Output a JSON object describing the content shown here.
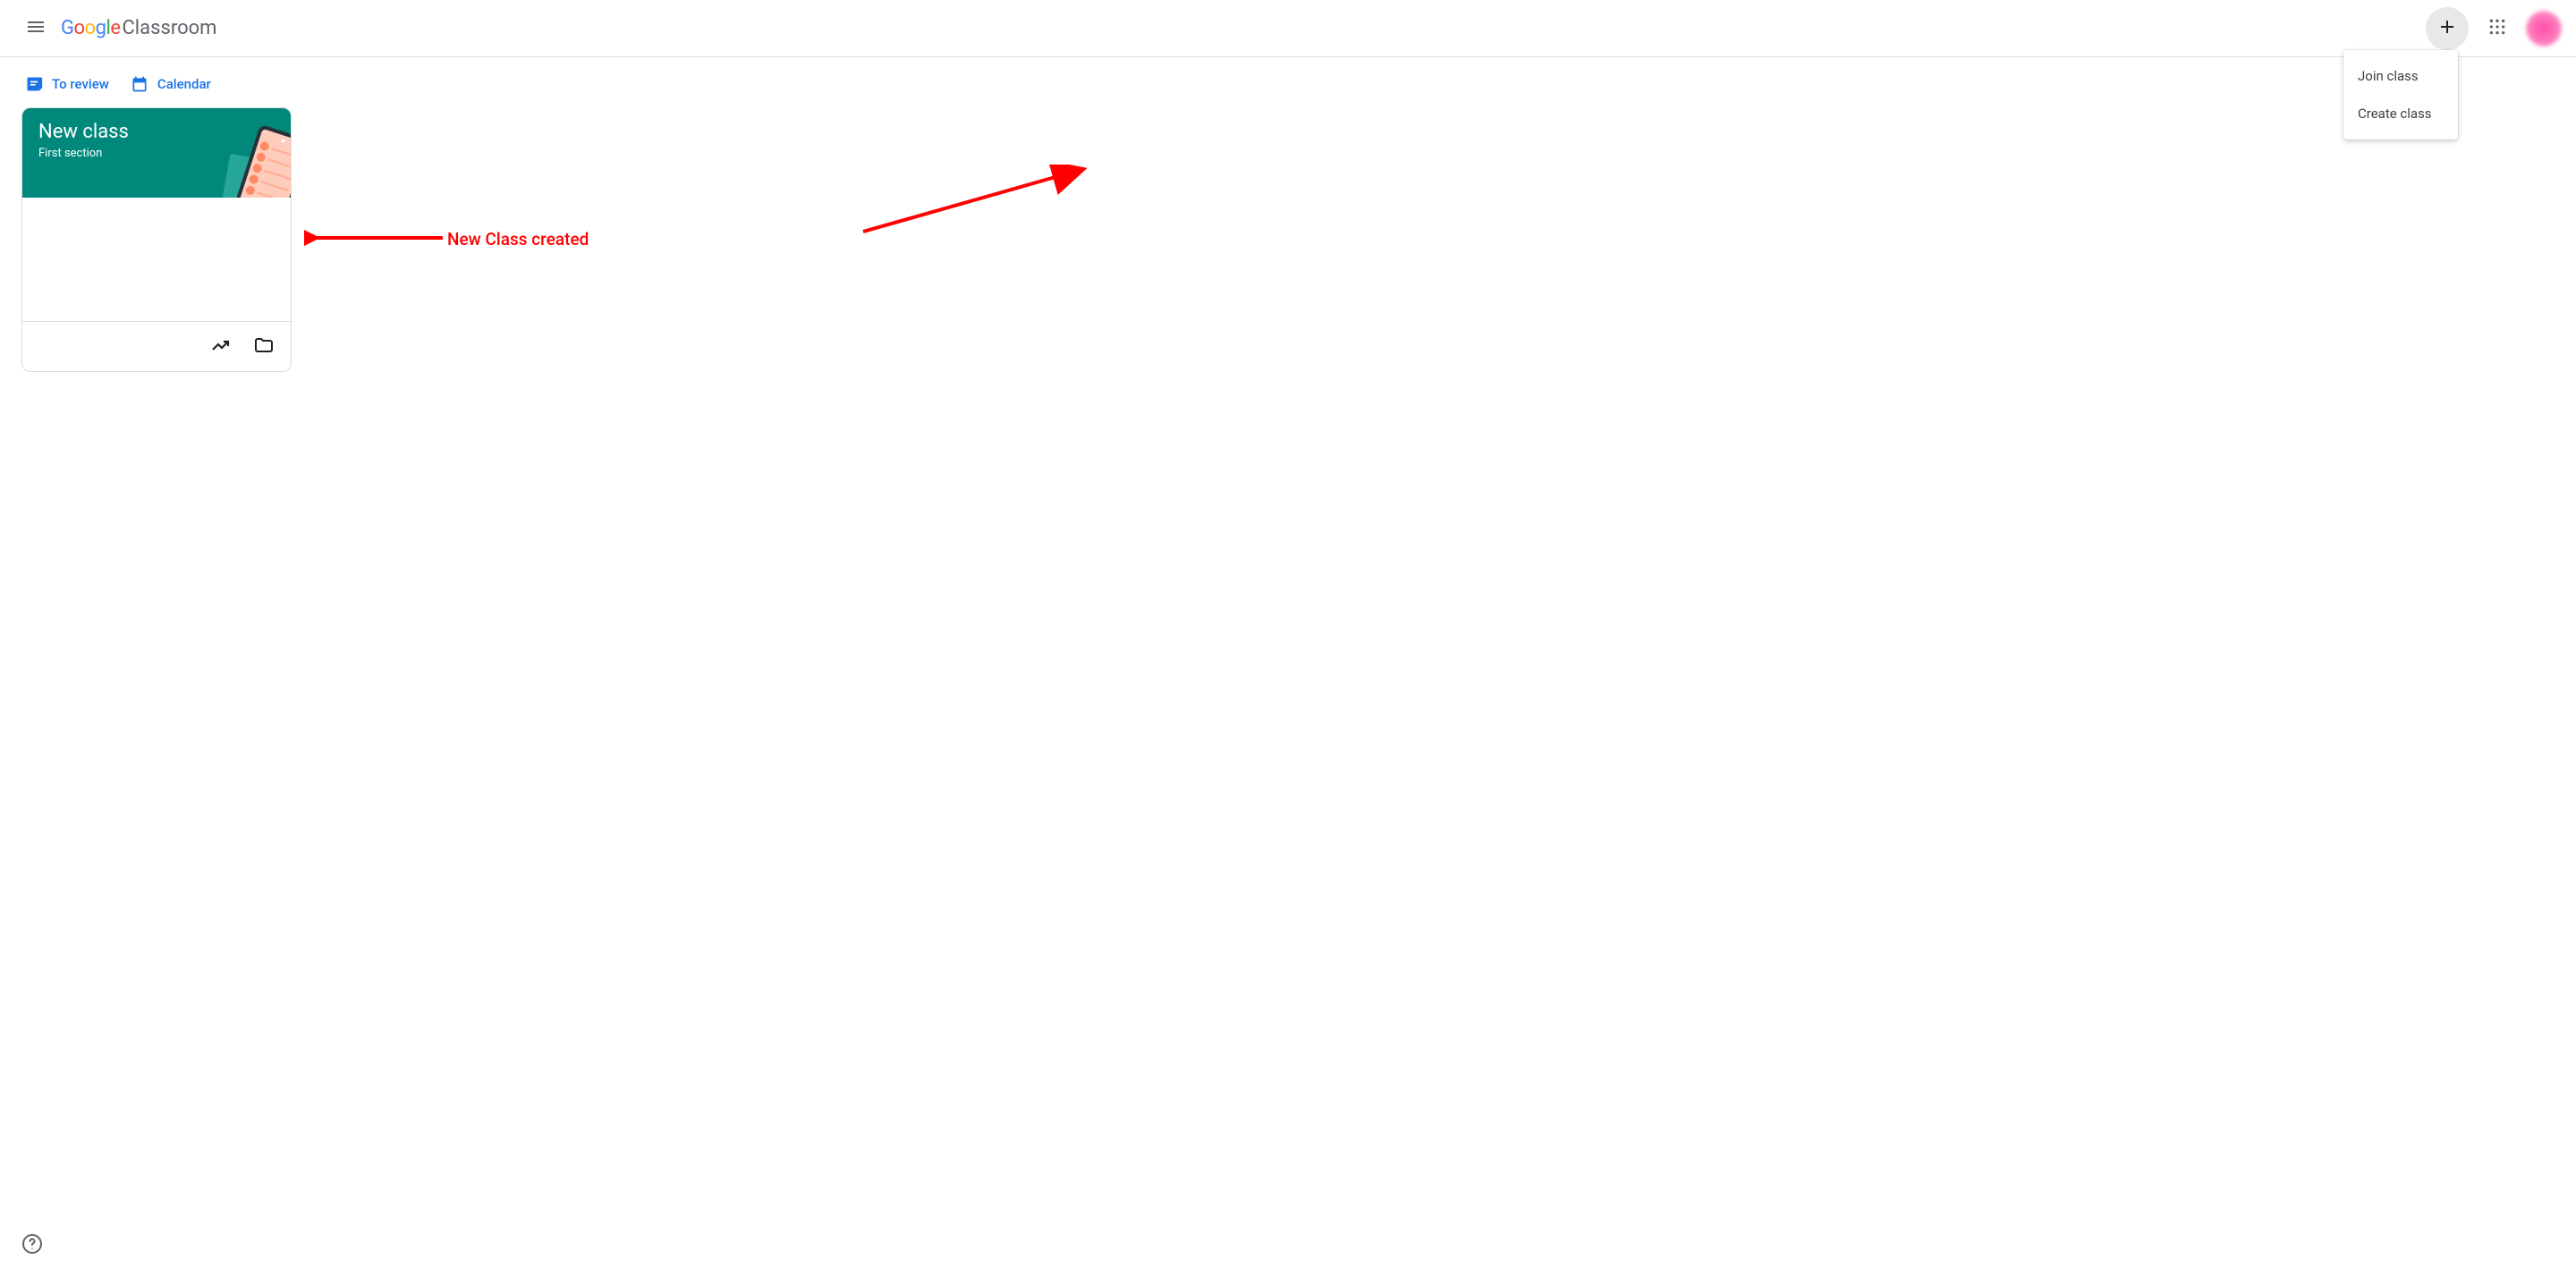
{
  "header": {
    "logo_google": "Google",
    "logo_product": "Classroom"
  },
  "dropdown": {
    "join_label": "Join class",
    "create_label": "Create class"
  },
  "toolbar": {
    "review_label": "To review",
    "calendar_label": "Calendar"
  },
  "cards": [
    {
      "title": "New class",
      "section": "First section"
    }
  ],
  "annotations": {
    "created_label": "New Class created"
  }
}
